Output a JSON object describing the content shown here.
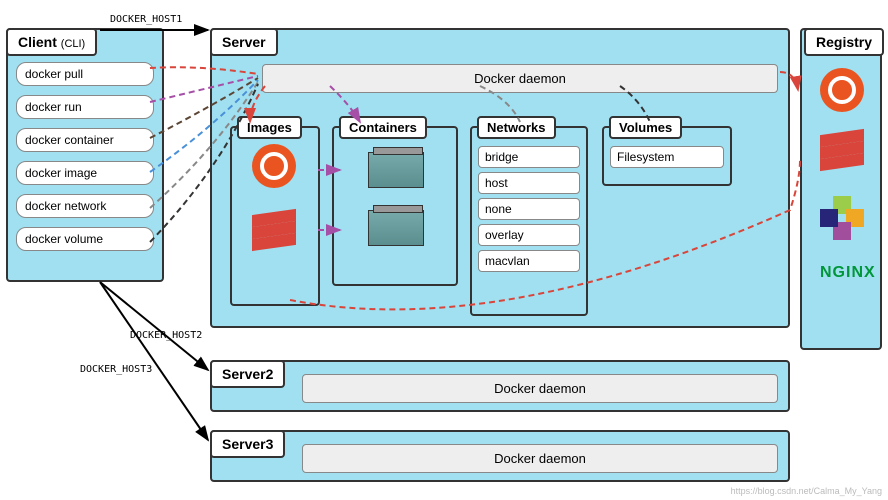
{
  "client": {
    "title": "Client",
    "subtitle": "(CLI)",
    "commands": [
      "docker pull",
      "docker run",
      "docker container",
      "docker image",
      "docker network",
      "docker volume"
    ]
  },
  "server": {
    "title": "Server",
    "daemon": "Docker daemon",
    "images": {
      "title": "Images"
    },
    "containers": {
      "title": "Containers"
    },
    "networks": {
      "title": "Networks",
      "items": [
        "bridge",
        "host",
        "none",
        "overlay",
        "macvlan"
      ]
    },
    "volumes": {
      "title": "Volumes",
      "item": "Filesystem"
    }
  },
  "server2": {
    "title": "Server2",
    "daemon": "Docker daemon"
  },
  "server3": {
    "title": "Server3",
    "daemon": "Docker daemon"
  },
  "registry": {
    "title": "Registry",
    "nginx": "NGINX"
  },
  "edges": {
    "host1": "DOCKER_HOST1",
    "host2": "DOCKER_HOST2",
    "host3": "DOCKER_HOST3"
  },
  "watermark": "https://blog.csdn.net/Calma_My_Yang",
  "chart_data": {
    "type": "diagram",
    "title": "Docker Architecture",
    "nodes": [
      {
        "id": "client",
        "label": "Client (CLI)",
        "commands": [
          "docker pull",
          "docker run",
          "docker container",
          "docker image",
          "docker network",
          "docker volume"
        ]
      },
      {
        "id": "server",
        "label": "Server",
        "components": [
          "Docker daemon",
          "Images",
          "Containers",
          "Networks",
          "Volumes"
        ]
      },
      {
        "id": "server2",
        "label": "Server2",
        "components": [
          "Docker daemon"
        ]
      },
      {
        "id": "server3",
        "label": "Server3",
        "components": [
          "Docker daemon"
        ]
      },
      {
        "id": "registry",
        "label": "Registry",
        "images": [
          "ubuntu",
          "redis",
          "centos",
          "nginx"
        ]
      },
      {
        "id": "images",
        "parent": "server",
        "content": [
          "ubuntu",
          "redis"
        ]
      },
      {
        "id": "containers",
        "parent": "server"
      },
      {
        "id": "networks",
        "parent": "server",
        "items": [
          "bridge",
          "host",
          "none",
          "overlay",
          "macvlan"
        ]
      },
      {
        "id": "volumes",
        "parent": "server",
        "items": [
          "Filesystem"
        ]
      }
    ],
    "edges": [
      {
        "from": "client",
        "to": "server",
        "label": "DOCKER_HOST1",
        "style": "solid"
      },
      {
        "from": "client",
        "to": "server2",
        "label": "DOCKER_HOST2",
        "style": "solid"
      },
      {
        "from": "client",
        "to": "server3",
        "label": "DOCKER_HOST3",
        "style": "solid"
      },
      {
        "from": "docker pull",
        "to": "Docker daemon",
        "style": "dashed",
        "color": "#d9453a"
      },
      {
        "from": "docker run",
        "to": "Docker daemon",
        "style": "dashed",
        "color": "#a64fa6"
      },
      {
        "from": "docker container",
        "to": "Docker daemon",
        "style": "dashed",
        "color": "#5b4636"
      },
      {
        "from": "docker image",
        "to": "Docker daemon",
        "style": "dashed",
        "color": "#4a90d9"
      },
      {
        "from": "docker network",
        "to": "Docker daemon",
        "style": "dashed",
        "color": "#888"
      },
      {
        "from": "docker volume",
        "to": "Docker daemon",
        "style": "dashed",
        "color": "#333"
      },
      {
        "from": "Docker daemon",
        "to": "Registry",
        "style": "dashed",
        "color": "#d9453a"
      },
      {
        "from": "Docker daemon",
        "to": "Images",
        "style": "dashed",
        "color": "#d9453a"
      },
      {
        "from": "Docker daemon",
        "to": "Containers",
        "style": "dashed",
        "color": "#a64fa6"
      },
      {
        "from": "Docker daemon",
        "to": "Networks",
        "style": "dashed",
        "color": "#888"
      },
      {
        "from": "Docker daemon",
        "to": "Volumes",
        "style": "dashed",
        "color": "#333"
      },
      {
        "from": "Images",
        "to": "Containers",
        "style": "dashed",
        "color": "#a64fa6"
      },
      {
        "from": "Images",
        "to": "Registry",
        "style": "dashed",
        "color": "#d9453a"
      }
    ]
  }
}
